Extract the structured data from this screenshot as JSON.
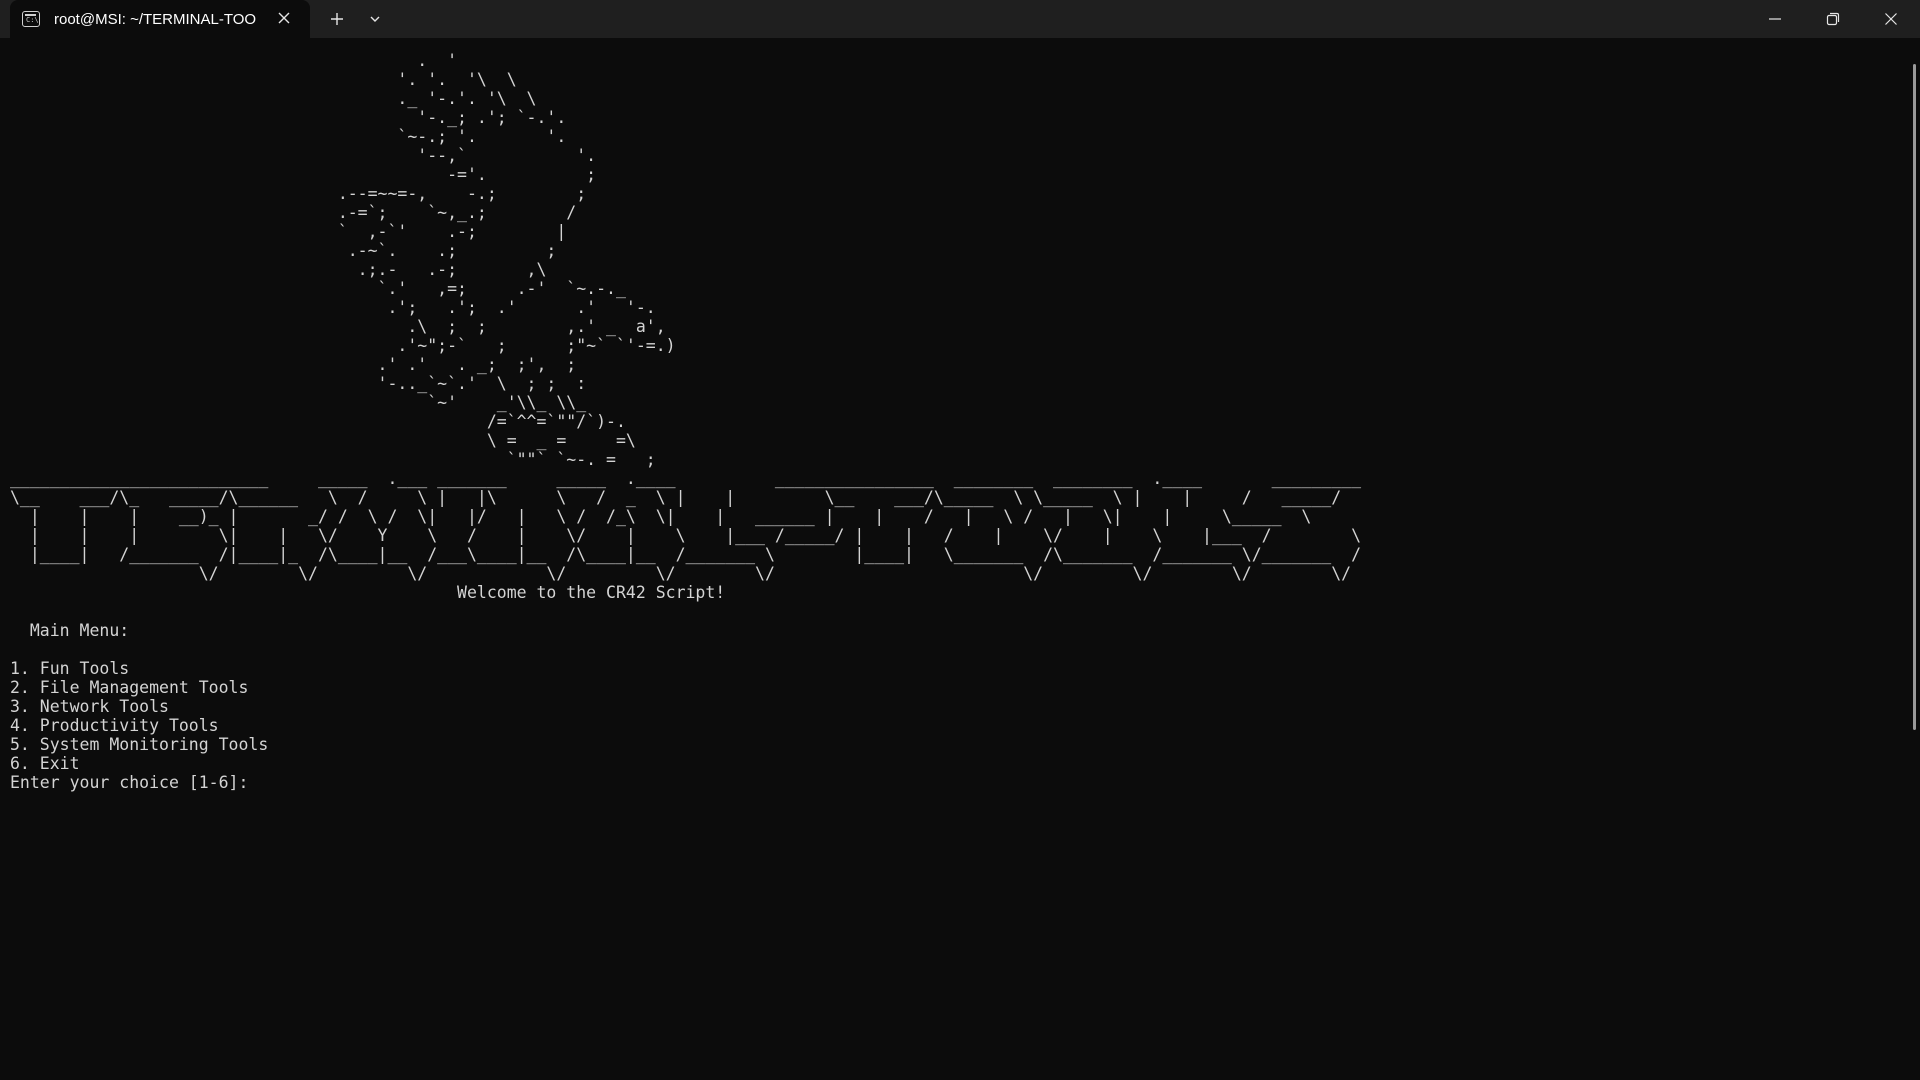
{
  "window": {
    "tab_title": "root@MSI: ~/TERMINAL-TOO",
    "tab_icon": "terminal-icon",
    "tab_icon_glyph": "C:\\",
    "controls": [
      "close-icon",
      "plus-icon",
      "chevron-down-icon",
      "minimize-icon",
      "restore-icon",
      "close-window-icon"
    ]
  },
  "terminal": {
    "ascii_art": "                                         .  '\n                                       '. '.  '\\  \\\n                                       ._ '-.'. '\\  \\\n                                         '-._; .'; `-.'.\n                                       `~-.; '.       '.\n                                         '--,`           '.\n                                            -='.          ;\n                                 .--=~~=-,    -.;        ;\n                                 .-=`;    `~,_.;        /\n                                 `  ,-`'    .-;        |\n                                  .-~`.    .;         ;\n                                   .;.-   .-;       ,\\\n                                     `.'   ,=;     .-'  `~.-._\n                                      .';   .';  .'      .'   '-.\n                                        .\\  ;  ;        ,.' _  a',\n                                       .'~\";-`   ;      ;\"~` `'-=.)\n                                     .' .'   . _;  ;',  ;\n                                     '-.._`~`.'  \\  ; ;  :\n                                          `~'    _'\\\\_ \\\\_\n                                                /=`^^=`\"\"/`)-.\n                                                \\ =  _ =     =\\\n                                                  `\"\"` `~-. =   ;\n__________________________     _____  .___ _______     _____  .____          ________________  ________  ________  .____       _________\n\\__    ___/\\_   _____/\\______   \\  /     \\ |   |\\      \\   /  _  \\ |    |         \\__    ___/\\_____  \\ \\_____  \\ |    |     /   _____/\n  |    |    |    __)_ |       _/ /  \\ /  \\|   |/   |   \\ /  /_\\  \\|    |   ______ |    |    /   |   \\ /   |   \\|    |     \\_____  \\\n  |    |    |        \\|    |   \\/    Y    \\   /    |    \\/    |    \\    |___ /_____/ |    |   /    |    \\/    |    \\    |___  /        \\\n  |____|   /_______  /|____|_  /\\____|__  /___\\____|__  /\\____|__  /_______ \\        |____|   \\_______  /\\_______  /_______ \\/_______  /\n                   \\/        \\/         \\/            \\/         \\/        \\/                         \\/         \\/        \\/        \\/\n",
    "welcome": "                                             Welcome to the CR42 Script!",
    "menu_title": "  Main Menu:",
    "menu_items": [
      "1. Fun Tools",
      "2. File Management Tools",
      "3. Network Tools",
      "4. Productivity Tools",
      "5. System Monitoring Tools",
      "6. Exit"
    ],
    "prompt": "Enter your choice [1-6]: "
  }
}
